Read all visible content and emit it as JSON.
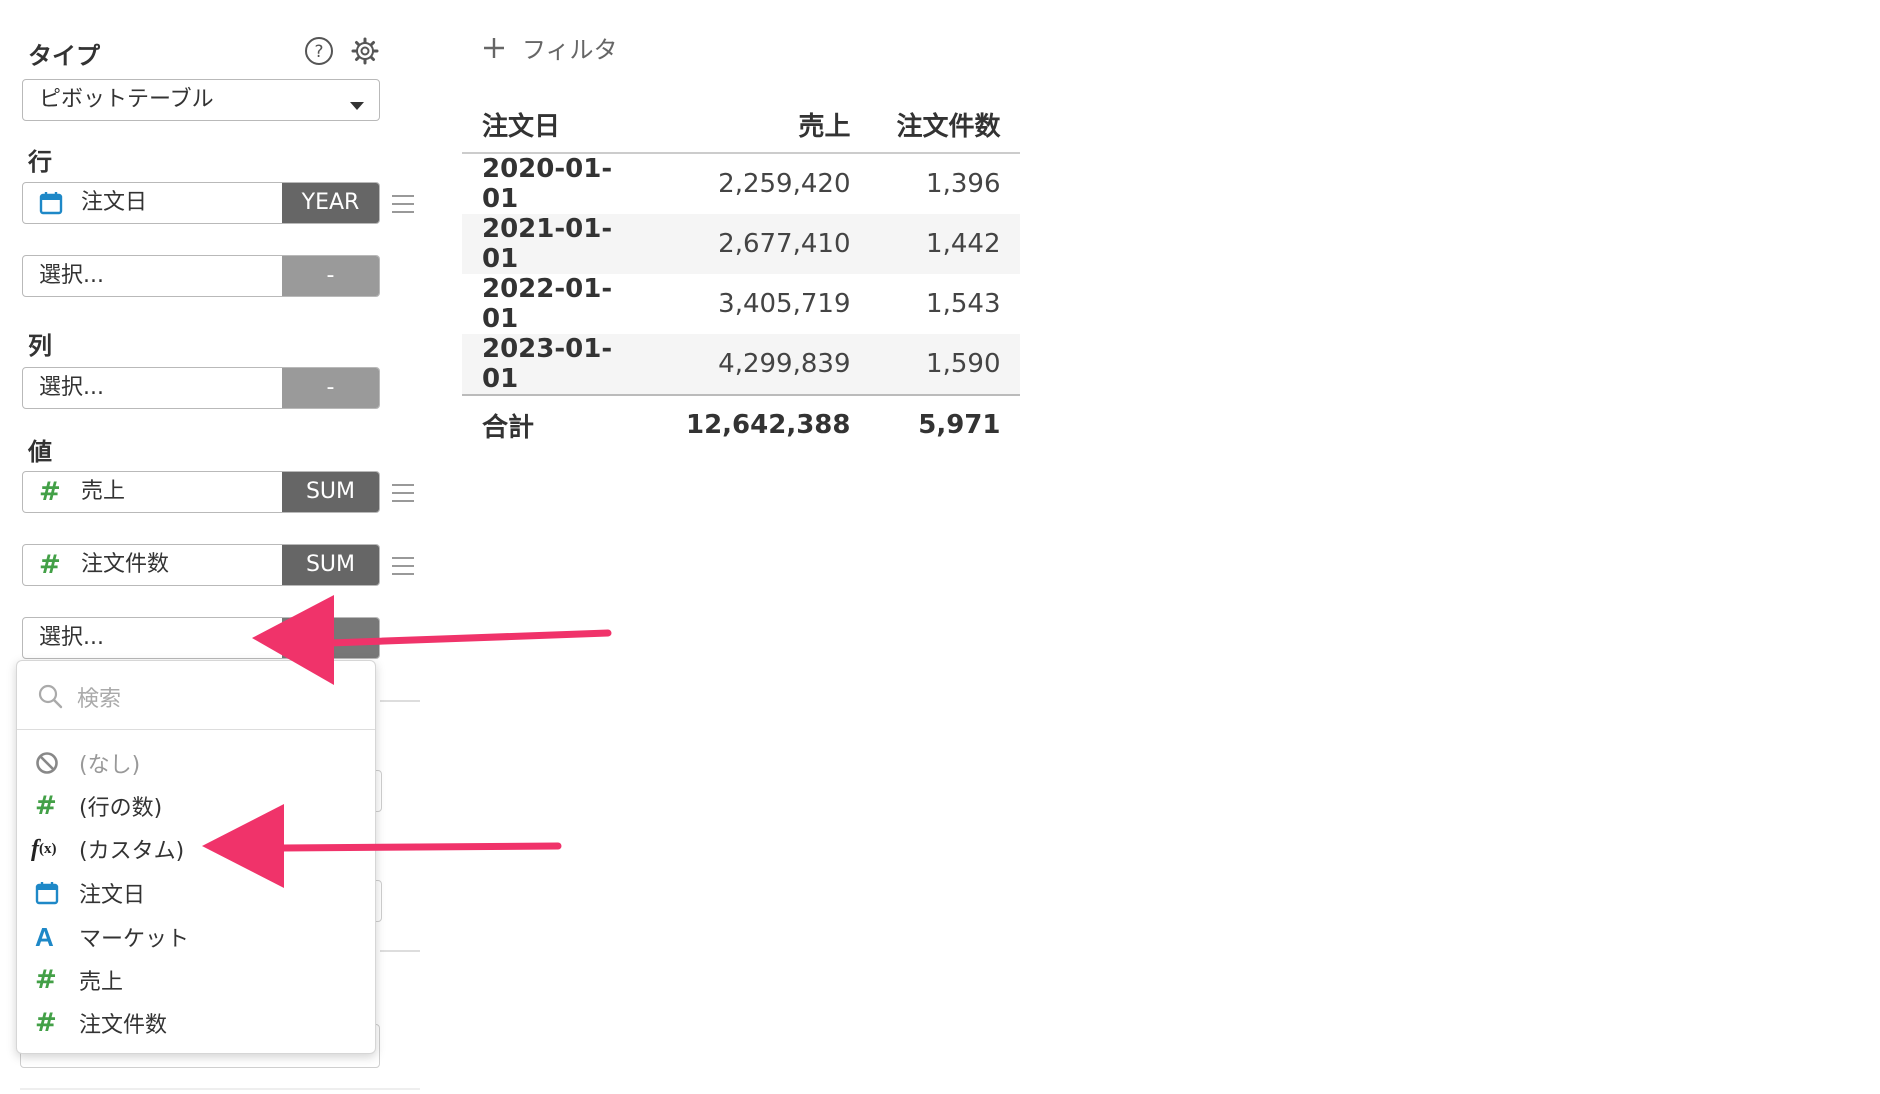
{
  "panel": {
    "type_label": "タイプ",
    "type_value": "ピボットテーブル",
    "rows_label": "行",
    "rows": [
      {
        "icon": "calendar-icon",
        "label": "注文日",
        "agg": "YEAR"
      },
      {
        "label": "選択...",
        "agg": "-"
      }
    ],
    "cols_label": "列",
    "cols": [
      {
        "label": "選択...",
        "agg": "-"
      }
    ],
    "values_label": "値",
    "values": [
      {
        "icon": "hash-icon",
        "label": "売上",
        "agg": "SUM"
      },
      {
        "icon": "hash-icon",
        "label": "注文件数",
        "agg": "SUM"
      },
      {
        "label": "選択..."
      }
    ]
  },
  "filter": {
    "label": "フィルタ",
    "icon": "plus-icon"
  },
  "table": {
    "headers": [
      "注文日",
      "売上",
      "注文件数"
    ],
    "rows": [
      [
        "2020-01-01",
        "2,259,420",
        "1,396"
      ],
      [
        "2021-01-01",
        "2,677,410",
        "1,442"
      ],
      [
        "2022-01-01",
        "3,405,719",
        "1,543"
      ],
      [
        "2023-01-01",
        "4,299,839",
        "1,590"
      ]
    ],
    "total": [
      "合計",
      "12,642,388",
      "5,971"
    ]
  },
  "dropdown": {
    "search_placeholder": "検索",
    "items": [
      {
        "icon": "none-icon",
        "label": "(なし)"
      },
      {
        "icon": "hash-icon",
        "label": "(行の数)"
      },
      {
        "icon": "fx-icon",
        "label": "(カスタム)"
      },
      {
        "icon": "calendar-icon",
        "label": "注文日"
      },
      {
        "icon": "text-type-icon",
        "label": "マーケット"
      },
      {
        "icon": "hash-icon",
        "label": "売上"
      },
      {
        "icon": "hash-icon",
        "label": "注文件数"
      }
    ]
  },
  "colors": {
    "arrow": "#f0336a",
    "agg_dark": "#666666",
    "agg_empty": "#9a9a9a",
    "hash_green": "#43a047",
    "calendar_blue": "#1e88c7"
  }
}
